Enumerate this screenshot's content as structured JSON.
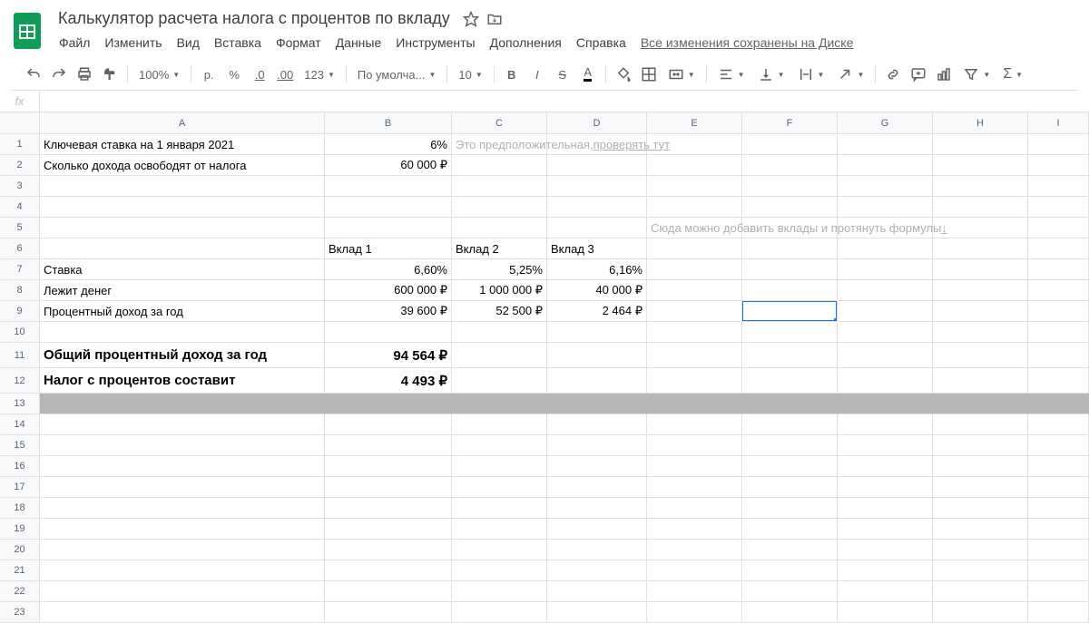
{
  "doc": {
    "title": "Калькулятор расчета налога с процентов по вкладу"
  },
  "menu": {
    "file": "Файл",
    "edit": "Изменить",
    "view": "Вид",
    "insert": "Вставка",
    "format": "Формат",
    "data": "Данные",
    "tools": "Инструменты",
    "addons": "Дополнения",
    "help": "Справка",
    "save_status": "Все изменения сохранены на Диске"
  },
  "toolbar": {
    "zoom": "100%",
    "currency": "р.",
    "percent": "%",
    "dec_less": ".0",
    "dec_more": ".00",
    "fmt123": "123",
    "font": "По умолча...",
    "font_size": "10",
    "bold": "B",
    "italic": "I",
    "strike": "S",
    "textcolor": "A"
  },
  "fx": "fx",
  "columns": {
    "A": "A",
    "B": "B",
    "C": "C",
    "D": "D",
    "E": "E",
    "F": "F",
    "G": "G",
    "H": "H",
    "I": "I"
  },
  "rows": {
    "r1": {
      "A": "Ключевая ставка на 1 января 2021",
      "B": "6%",
      "C_hint": "Это предположительная, ",
      "C_hint_link": "проверять тут"
    },
    "r2": {
      "A": "Сколько дохода освободят от налога",
      "B": "60 000 ₽"
    },
    "r5": {
      "E_hint": "Сюда можно добавить вклады и протянуть формулы ",
      "E_hint_link": "↓"
    },
    "r6": {
      "B": "Вклад 1",
      "C": "Вклад 2",
      "D": "Вклад 3"
    },
    "r7": {
      "A": "Ставка",
      "B": "6,60%",
      "C": "5,25%",
      "D": "6,16%"
    },
    "r8": {
      "A": "Лежит денег",
      "B": "600 000 ₽",
      "C": "1 000 000 ₽",
      "D": "40 000 ₽"
    },
    "r9": {
      "A": "Процентный доход за год",
      "B": "39 600 ₽",
      "C": "52 500 ₽",
      "D": "2 464 ₽"
    },
    "r11": {
      "A": "Общий процентный доход за год",
      "B": "94 564 ₽"
    },
    "r12": {
      "A": "Налог с процентов составит",
      "B": "4 493 ₽"
    }
  },
  "selected_cell": "F9"
}
